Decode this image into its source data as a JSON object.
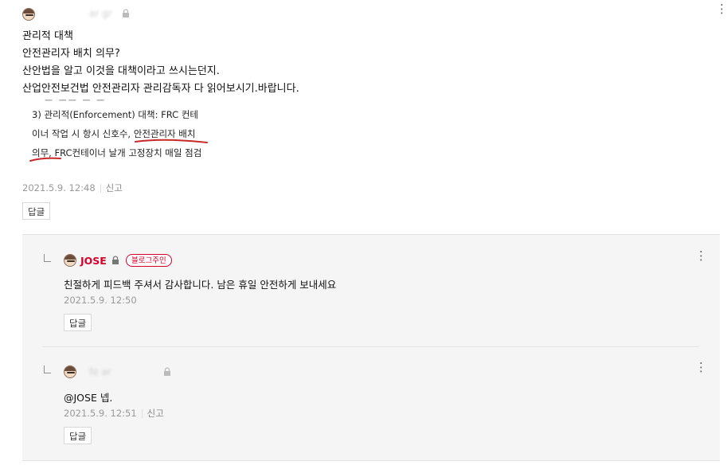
{
  "comment": {
    "author_blurred": "ar gr",
    "lines": [
      "관리적 대책",
      "안전관리자 배치 의무?",
      "산안법을 알고 이것을 대책이라고 쓰시는던지.",
      "산업안전보건법 안전관리자 관리감독자 다 읽어보시기.바랍니다."
    ],
    "image_text": {
      "line1": "3) 관리적(Enforcement) 대책:  FRC 컨테",
      "line2_prefix": "이너 작업 시 항시 신호수, ",
      "line2_underlined": "안전관리자 배치",
      "line3_underlined": "의무",
      "line3_rest": ", FRC컨테이너 날개 고정장치 매일 점검"
    },
    "date": "2021.5.9. 12:48",
    "report_label": "신고",
    "reply_label": "답글"
  },
  "replies": [
    {
      "author": "JOSE",
      "badge": "블로그주인",
      "text": "친절하게 피드백 주셔서 감사합니다. 남은 휴일 안전하게 보내세요",
      "date": "2021.5.9. 12:50",
      "reply_label": "답글"
    },
    {
      "author_blurred": "fe    ar",
      "text": "@JOSE 넵.",
      "date": "2021.5.9. 12:51",
      "report_label": "신고",
      "reply_label": "답글"
    }
  ],
  "colors": {
    "owner_red": "#d4002a",
    "underline_red": "#c62828",
    "reply_bg": "#f5f5f5"
  },
  "icons": [
    "avatar-icon",
    "lock-icon",
    "more-icon"
  ]
}
